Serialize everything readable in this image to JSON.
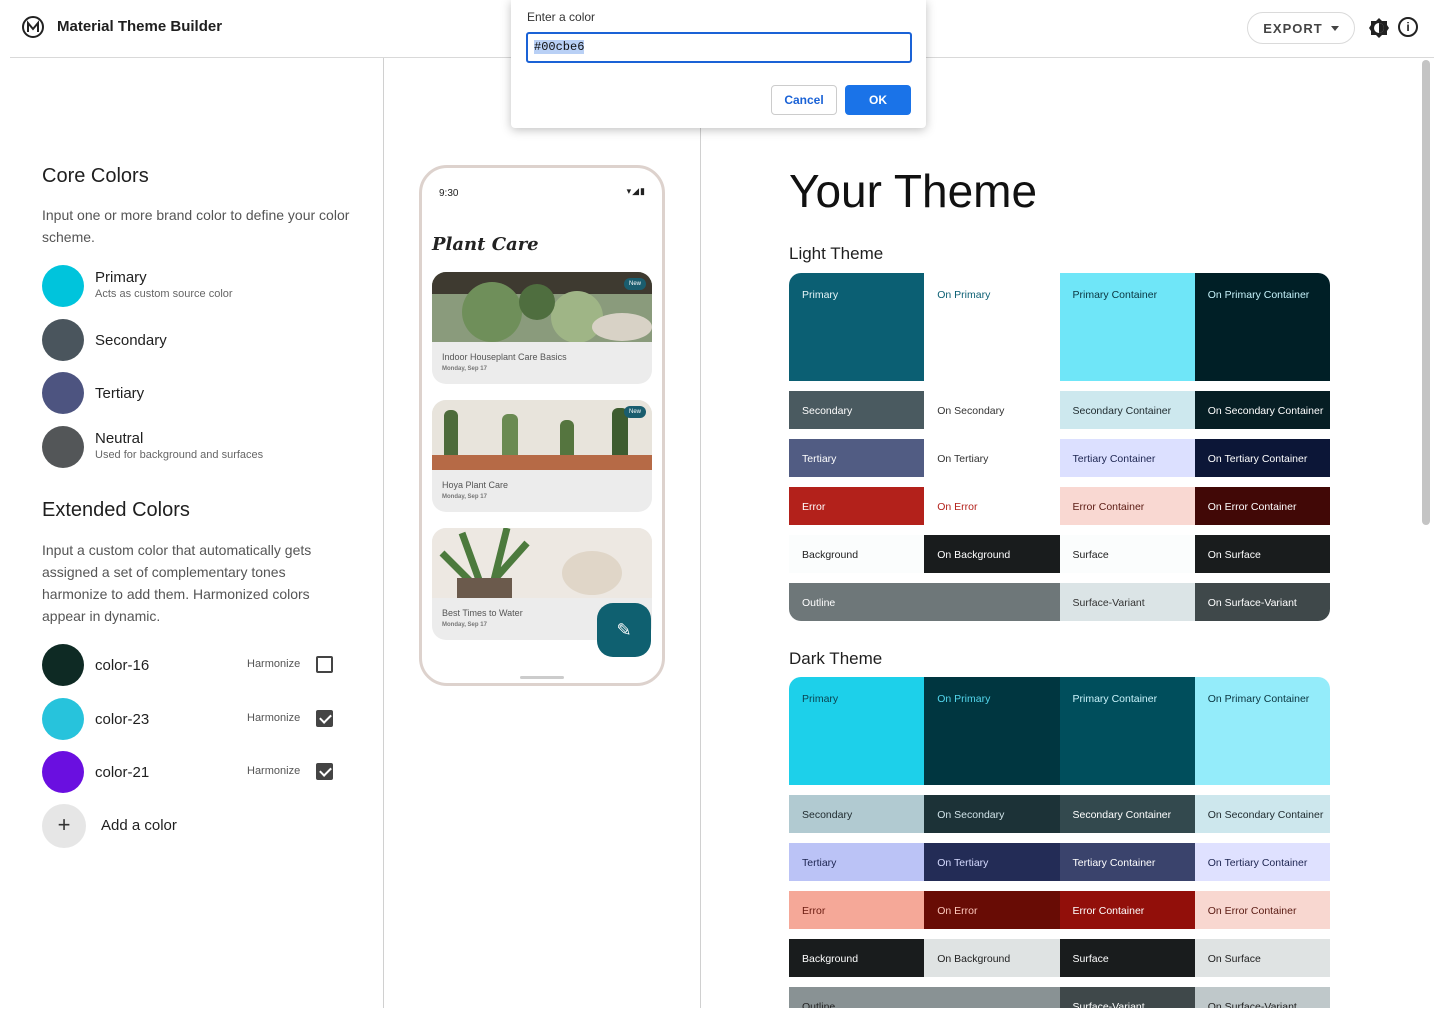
{
  "header": {
    "app_title": "Material Theme Builder",
    "export_label": "EXPORT",
    "info_glyph": "i"
  },
  "dialog": {
    "label": "Enter a color",
    "input_value": "#00cbe6",
    "cancel_label": "Cancel",
    "ok_label": "OK"
  },
  "core": {
    "title": "Core Colors",
    "description": "Input one or more brand color to define your color scheme.",
    "items": [
      {
        "name": "Primary",
        "sub": "Acts as custom source color",
        "color": "#00c4dc"
      },
      {
        "name": "Secondary",
        "sub": "",
        "color": "#4a555d"
      },
      {
        "name": "Tertiary",
        "sub": "",
        "color": "#4d5480"
      },
      {
        "name": "Neutral",
        "sub": "Used for background and surfaces",
        "color": "#535658"
      }
    ]
  },
  "extended": {
    "title": "Extended Colors",
    "description": "Input a custom color that automatically gets assigned a set of complementary tones harmonize to add them. Harmonized colors appear in dynamic.",
    "harmonize_label": "Harmonize",
    "items": [
      {
        "name": "color-16",
        "color": "#0e2a24",
        "checked": false
      },
      {
        "name": "color-23",
        "color": "#27c3dc",
        "checked": true
      },
      {
        "name": "color-21",
        "color": "#6a0fe0",
        "checked": true
      }
    ],
    "add_label": "Add a color"
  },
  "phone": {
    "time": "9:30",
    "status": "▾◢▮",
    "title": "Plant Care",
    "cards": [
      {
        "title": "Indoor Houseplant Care Basics",
        "date": "Monday, Sep 17",
        "badge": "New"
      },
      {
        "title": "Hoya Plant Care",
        "date": "Monday, Sep 17",
        "badge": "New"
      },
      {
        "title": "Best Times to Water",
        "date": "Monday, Sep 17",
        "badge": ""
      }
    ],
    "fab_icon": "✎"
  },
  "theme": {
    "title": "Your Theme",
    "light_label": "Light Theme",
    "dark_label": "Dark Theme",
    "light_rows": [
      [
        {
          "t": "Primary",
          "bg": "#0b5f73",
          "fg": "#e6f5f8"
        },
        {
          "t": "On Primary",
          "bg": "#ffffff",
          "fg": "#0b5f73"
        },
        {
          "t": "Primary Container",
          "bg": "#6fe6f8",
          "fg": "#0a3540"
        },
        {
          "t": "On Primary Container",
          "bg": "#001f26",
          "fg": "#c5f2fa"
        }
      ],
      [
        {
          "t": "Secondary",
          "bg": "#4a5a60",
          "fg": "#ffffff"
        },
        {
          "t": "On Secondary",
          "bg": "#ffffff",
          "fg": "#333333"
        },
        {
          "t": "Secondary Container",
          "bg": "#cde8ee",
          "fg": "#1e2a2e"
        },
        {
          "t": "On Secondary Container",
          "bg": "#061e24",
          "fg": "#ffffff"
        }
      ],
      [
        {
          "t": "Tertiary",
          "bg": "#515c83",
          "fg": "#ffffff"
        },
        {
          "t": "On Tertiary",
          "bg": "#ffffff",
          "fg": "#333333"
        },
        {
          "t": "Tertiary Container",
          "bg": "#dce0ff",
          "fg": "#1c2450"
        },
        {
          "t": "On Tertiary Container",
          "bg": "#0c1637",
          "fg": "#ffffff"
        }
      ],
      [
        {
          "t": "Error",
          "bg": "#b3211b",
          "fg": "#ffffff"
        },
        {
          "t": "On Error",
          "bg": "#ffffff",
          "fg": "#b3211b"
        },
        {
          "t": "Error Container",
          "bg": "#f9d8d2",
          "fg": "#5a1a12"
        },
        {
          "t": "On Error Container",
          "bg": "#410806",
          "fg": "#ffffff"
        }
      ],
      [
        {
          "t": "Background",
          "bg": "#fbfdfd",
          "fg": "#222222"
        },
        {
          "t": "On Background",
          "bg": "#191c1d",
          "fg": "#ffffff"
        },
        {
          "t": "Surface",
          "bg": "#fbfdfd",
          "fg": "#222222"
        },
        {
          "t": "On Surface",
          "bg": "#191c1d",
          "fg": "#ffffff"
        }
      ],
      [
        {
          "t": "Outline",
          "bg": "#6e7779",
          "fg": "#ffffff",
          "span": 2
        },
        {
          "t": "Surface-Variant",
          "bg": "#dbe4e6",
          "fg": "#333333"
        },
        {
          "t": "On Surface-Variant",
          "bg": "#3f484a",
          "fg": "#ffffff"
        }
      ]
    ],
    "dark_rows": [
      [
        {
          "t": "Primary",
          "bg": "#1dd0ea",
          "fg": "#0b4451"
        },
        {
          "t": "On Primary",
          "bg": "#003640",
          "fg": "#53d6ec"
        },
        {
          "t": "Primary Container",
          "bg": "#004e5c",
          "fg": "#c9f3fb"
        },
        {
          "t": "On Primary Container",
          "bg": "#94ecfa",
          "fg": "#0a3540"
        }
      ],
      [
        {
          "t": "Secondary",
          "bg": "#b1cad1",
          "fg": "#1e2a2e"
        },
        {
          "t": "On Secondary",
          "bg": "#1c3237",
          "fg": "#d0e3e8"
        },
        {
          "t": "Secondary Container",
          "bg": "#33494e",
          "fg": "#ffffff"
        },
        {
          "t": "On Secondary Container",
          "bg": "#cde7ed",
          "fg": "#1e2a2e"
        }
      ],
      [
        {
          "t": "Tertiary",
          "bg": "#bbc3f6",
          "fg": "#1c2450"
        },
        {
          "t": "On Tertiary",
          "bg": "#232c56",
          "fg": "#d6dbff"
        },
        {
          "t": "Tertiary Container",
          "bg": "#3a436c",
          "fg": "#ffffff"
        },
        {
          "t": "On Tertiary Container",
          "bg": "#dfe1ff",
          "fg": "#1c2450"
        }
      ],
      [
        {
          "t": "Error",
          "bg": "#f5a898",
          "fg": "#6a1b10"
        },
        {
          "t": "On Error",
          "bg": "#680c05",
          "fg": "#ffc9bd"
        },
        {
          "t": "Error Container",
          "bg": "#920f0a",
          "fg": "#ffffff"
        },
        {
          "t": "On Error Container",
          "bg": "#f8d7d0",
          "fg": "#5a1a12"
        }
      ],
      [
        {
          "t": "Background",
          "bg": "#191c1d",
          "fg": "#ffffff"
        },
        {
          "t": "On Background",
          "bg": "#dfe3e3",
          "fg": "#222222"
        },
        {
          "t": "Surface",
          "bg": "#191c1d",
          "fg": "#ffffff"
        },
        {
          "t": "On Surface",
          "bg": "#dfe3e3",
          "fg": "#222222"
        }
      ],
      [
        {
          "t": "Outline",
          "bg": "#899294",
          "fg": "#222222",
          "span": 2
        },
        {
          "t": "Surface-Variant",
          "bg": "#3f484a",
          "fg": "#ffffff"
        },
        {
          "t": "On Surface-Variant",
          "bg": "#bfc8ca",
          "fg": "#222222"
        }
      ]
    ]
  }
}
